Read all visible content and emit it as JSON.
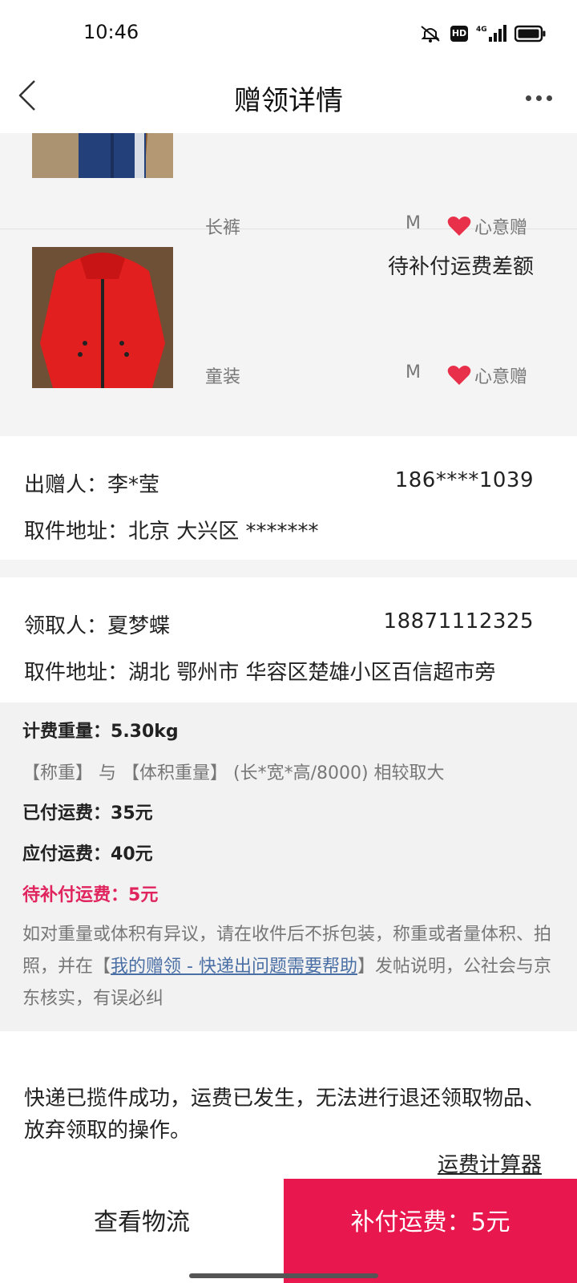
{
  "status_bar": {
    "time": "10:46",
    "icons": [
      "mute-icon",
      "hd-icon",
      "signal-4g-icon",
      "battery-icon"
    ],
    "hd_label": "HD",
    "network_label": "4G"
  },
  "nav": {
    "title": "赠领详情",
    "back_icon": "chevron-left-icon",
    "more_icon": "more-dots-icon"
  },
  "items": [
    {
      "name": "长裤",
      "size": "M",
      "tag": "心意赠",
      "status": "",
      "image": "blue-pants-photo"
    },
    {
      "name": "童装",
      "size": "M",
      "tag": "心意赠",
      "status": "待补付运费差额",
      "image": "red-jacket-photo"
    }
  ],
  "giver": {
    "label": "出赠人：",
    "name": "李*莹",
    "phone": "186****1039",
    "address_label": "取件地址：",
    "address": "北京 大兴区 *******"
  },
  "receiver": {
    "label": "领取人：",
    "name": "夏梦蝶",
    "phone": "18871112325",
    "address_label": "取件地址：",
    "address": "湖北 鄂州市 华容区楚雄小区百信超市旁"
  },
  "freight": {
    "weight_label": "计费重量：",
    "weight": "5.30kg",
    "rule_note": "【称重】 与 【体积重量】 (长*宽*高/8000) 相较取大",
    "paid_label": "已付运费：",
    "paid": "35元",
    "due_label": "应付运费：",
    "due": "40元",
    "pending_label": "待补付运费：",
    "pending": "5元",
    "dispute_prefix": "如对重量或体积有异议，请在收件后不拆包装，称重或者量体积、拍照，并在【",
    "dispute_link": "我的赠领 - 快递出问题需要帮助",
    "dispute_suffix": "】发帖说明，公社会与京东核实，有误必纠"
  },
  "notice": {
    "text": "快递已揽件成功，运费已发生，无法进行退还领取物品、放弃领取的操作。",
    "calculator_link": "运费计算器"
  },
  "bottom": {
    "logistics_label": "查看物流",
    "pay_label": "补付运费：5元"
  },
  "colors": {
    "accent": "#e8174d",
    "pending_text": "#e0245e",
    "link": "#4a6fa5",
    "heart": "#e8304a"
  }
}
